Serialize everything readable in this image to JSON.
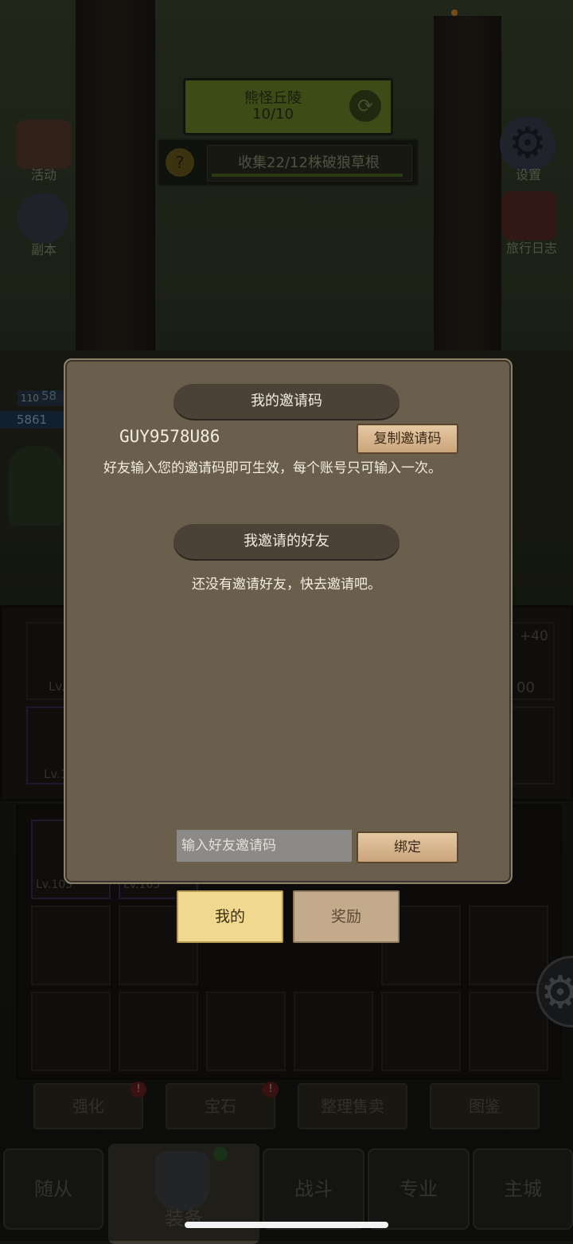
{
  "hud": {
    "stage_name": "熊怪丘陵",
    "stage_progress": "10/10",
    "quest_text": "收集22/12株破狼草根",
    "left_icons": [
      {
        "label": "活动",
        "icon": "event-icon"
      },
      {
        "label": "副本",
        "icon": "dungeon-icon"
      }
    ],
    "right_icons": [
      {
        "label": "设置",
        "icon": "gear-icon"
      },
      {
        "label": "旅行日志",
        "icon": "journal-icon"
      }
    ],
    "player_level_a": "110",
    "player_hp_a": "58",
    "player_hp_b": "5861"
  },
  "equipment": {
    "items": [
      "Lv.",
      "Lv.1",
      "+40",
      "00"
    ],
    "bag_levels": [
      "Lv.105",
      "Lv.105"
    ]
  },
  "sub_actions": [
    {
      "label": "强化",
      "badge": "!"
    },
    {
      "label": "宝石",
      "badge": "!"
    },
    {
      "label": "整理售卖"
    },
    {
      "label": "图鉴"
    }
  ],
  "bottom_nav": [
    {
      "label": "随从"
    },
    {
      "label": "装备",
      "active": true
    },
    {
      "label": "战斗"
    },
    {
      "label": "专业"
    },
    {
      "label": "主城"
    }
  ],
  "invite_dialog": {
    "my_code_title": "我的邀请码",
    "my_code": "GUY9578U86",
    "copy_button": "复制邀请码",
    "hint": "好友输入您的邀请码即可生效，每个账号只可输入一次。",
    "friends_title": "我邀请的好友",
    "no_friends": "还没有邀请好友，快去邀请吧。",
    "input_placeholder": "输入好友邀请码",
    "bind_button": "绑定",
    "tabs": [
      {
        "label": "我的",
        "active": true
      },
      {
        "label": "奖励",
        "active": false
      }
    ]
  },
  "colors": {
    "dialog_bg": "#6a5e4c",
    "banner_bg": "#4a4137",
    "tab_active": "#f0d98f",
    "tab_inactive": "#c2aa8a"
  }
}
